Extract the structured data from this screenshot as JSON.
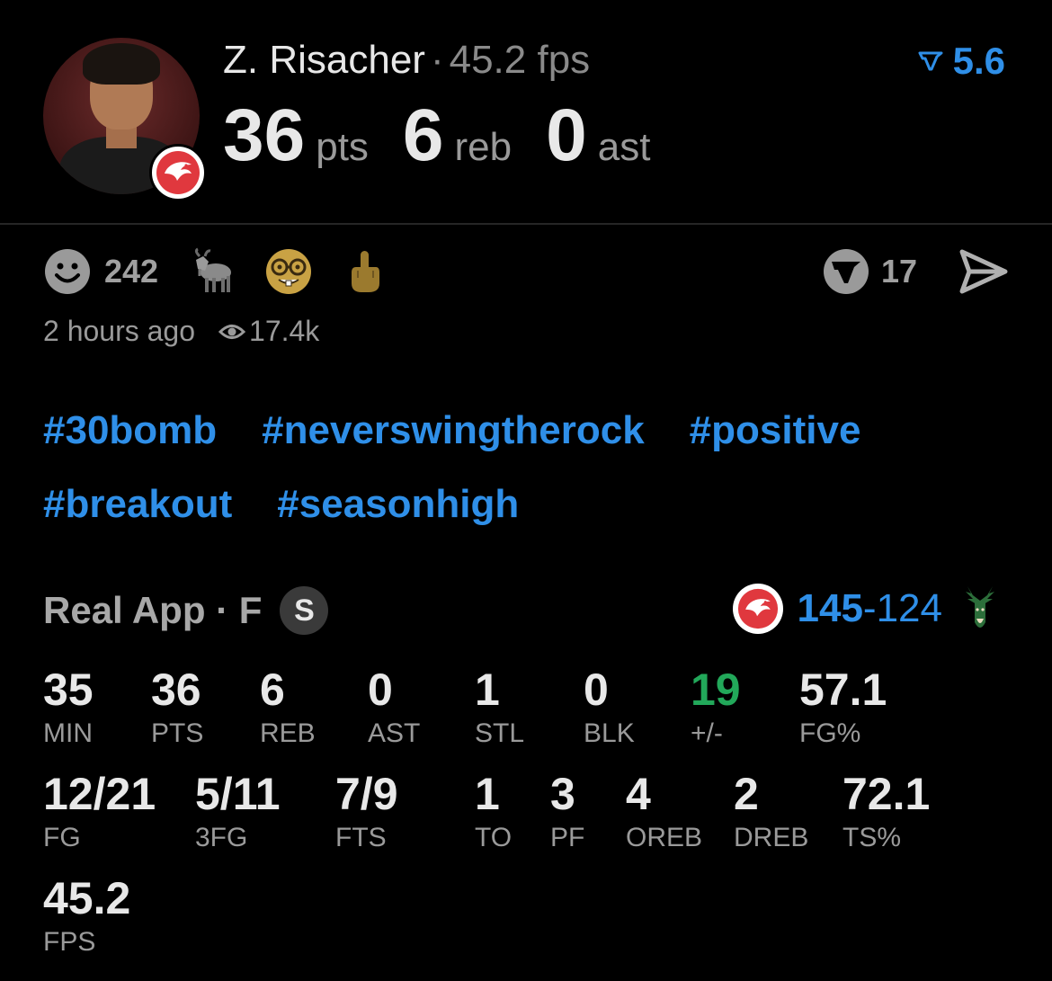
{
  "player": {
    "name": "Z. Risacher",
    "separator": "·",
    "fps": "45.2 fps",
    "rank": "5.6",
    "team_logo": "hawks-logo"
  },
  "headline_stats": [
    {
      "value": "36",
      "unit": "pts"
    },
    {
      "value": "6",
      "unit": "reb"
    },
    {
      "value": "0",
      "unit": "ast"
    }
  ],
  "reactions": {
    "smile_count": "242",
    "emojis": [
      "goat",
      "nerd-face",
      "middle-finger"
    ],
    "v_count": "17"
  },
  "meta": {
    "time_ago": "2 hours ago",
    "views": "17.4k"
  },
  "hashtags": [
    "#30bomb",
    "#neverswingtherock",
    "#positive",
    "#breakout",
    "#seasonhigh"
  ],
  "game": {
    "label": "Real App · F",
    "badge": "S",
    "home_score": "145",
    "score_sep": "-",
    "away_score": "124",
    "home_team_icon": "hawks-logo",
    "away_team_icon": "bucks-logo"
  },
  "box_score": {
    "row1": [
      {
        "value": "35",
        "label": "MIN"
      },
      {
        "value": "36",
        "label": "PTS"
      },
      {
        "value": "6",
        "label": "REB"
      },
      {
        "value": "0",
        "label": "AST"
      },
      {
        "value": "1",
        "label": "STL"
      },
      {
        "value": "0",
        "label": "BLK"
      },
      {
        "value": "19",
        "label": "+/-"
      },
      {
        "value": "57.1",
        "label": "FG%"
      }
    ],
    "row2": [
      {
        "value": "12/21",
        "label": "FG"
      },
      {
        "value": "5/11",
        "label": "3FG"
      },
      {
        "value": "7/9",
        "label": "FTS"
      },
      {
        "value": "1",
        "label": "TO"
      },
      {
        "value": "3",
        "label": "PF"
      },
      {
        "value": "4",
        "label": "OREB"
      },
      {
        "value": "2",
        "label": "DREB"
      },
      {
        "value": "72.1",
        "label": "TS%"
      }
    ],
    "row3": [
      {
        "value": "45.2",
        "label": "FPS"
      }
    ]
  },
  "colors": {
    "accent": "#2f8fe8",
    "positive": "#22a85a",
    "background": "#000000"
  }
}
